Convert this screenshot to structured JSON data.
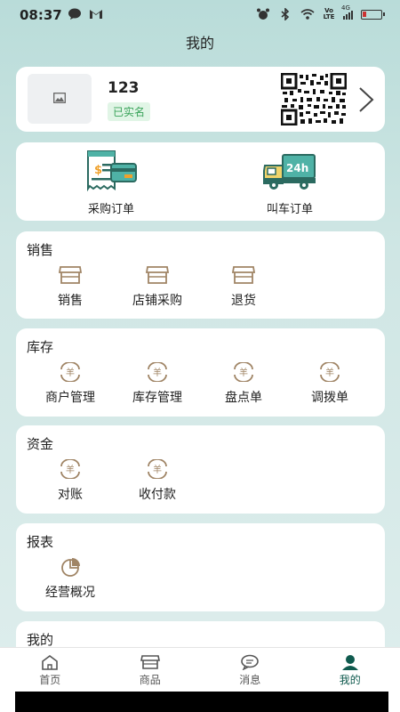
{
  "status_bar": {
    "time": "08:37",
    "network_type": "4G",
    "volte": "Vo LTE"
  },
  "page": {
    "title": "我的"
  },
  "profile": {
    "name": "123",
    "verified_label": "已实名"
  },
  "orders": [
    {
      "label": "采购订单",
      "icon": "receipt-card-icon"
    },
    {
      "label": "叫车订单",
      "icon": "delivery-truck-icon"
    }
  ],
  "truck_badge": "24h",
  "sections": {
    "sales": {
      "title": "销售",
      "items": [
        {
          "label": "销售",
          "icon": "store-icon"
        },
        {
          "label": "店铺采购",
          "icon": "store-icon"
        },
        {
          "label": "退货",
          "icon": "store-icon"
        }
      ]
    },
    "stock": {
      "title": "库存",
      "items": [
        {
          "label": "商户管理",
          "icon": "yuan-coin-icon"
        },
        {
          "label": "库存管理",
          "icon": "yuan-coin-icon"
        },
        {
          "label": "盘点单",
          "icon": "yuan-coin-icon"
        },
        {
          "label": "调拨单",
          "icon": "yuan-coin-icon"
        }
      ]
    },
    "fund": {
      "title": "资金",
      "items": [
        {
          "label": "对账",
          "icon": "yuan-coin-icon"
        },
        {
          "label": "收付款",
          "icon": "yuan-coin-icon"
        }
      ]
    },
    "report": {
      "title": "报表",
      "items": [
        {
          "label": "经营概况",
          "icon": "pie-chart-icon"
        }
      ]
    },
    "mine": {
      "title": "我的"
    }
  },
  "coin_symbol": "羊",
  "bottom_nav": [
    {
      "label": "首页",
      "icon": "home-icon"
    },
    {
      "label": "商品",
      "icon": "store-icon"
    },
    {
      "label": "消息",
      "icon": "chat-icon"
    },
    {
      "label": "我的",
      "icon": "person-icon",
      "active": true
    }
  ],
  "colors": {
    "accent": "#0f5a4e",
    "icon_tan": "#a08566",
    "verified_green": "#3aa35a"
  }
}
